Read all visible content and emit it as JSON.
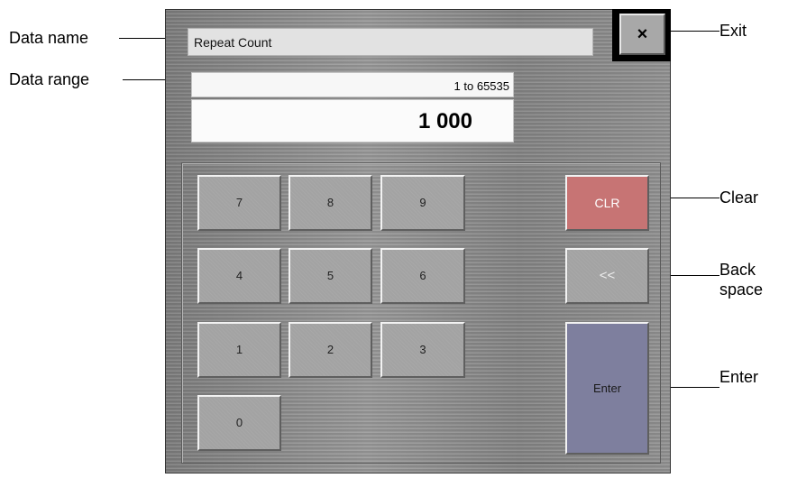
{
  "callouts": {
    "data_name": "Data name",
    "data_range": "Data range",
    "exit": "Exit",
    "clear": "Clear",
    "backspace_line1": "Back",
    "backspace_line2": "space",
    "enter": "Enter"
  },
  "dialog": {
    "data_name_value": "Repeat Count",
    "exit_symbol": "×",
    "range": "1 to 65535",
    "value": "1 000"
  },
  "keypad": {
    "digits": [
      "7",
      "8",
      "9",
      "4",
      "5",
      "6",
      "1",
      "2",
      "3",
      "0"
    ],
    "clear_label": "CLR",
    "backspace_label": "<<",
    "enter_label": "Enter"
  },
  "colors": {
    "clear_button": "#c77474",
    "enter_button": "#7e7f9e",
    "digit_button": "#a3a3a3"
  },
  "icons": {
    "exit": "close-icon",
    "backspace": "double-chevron-left-icon"
  }
}
